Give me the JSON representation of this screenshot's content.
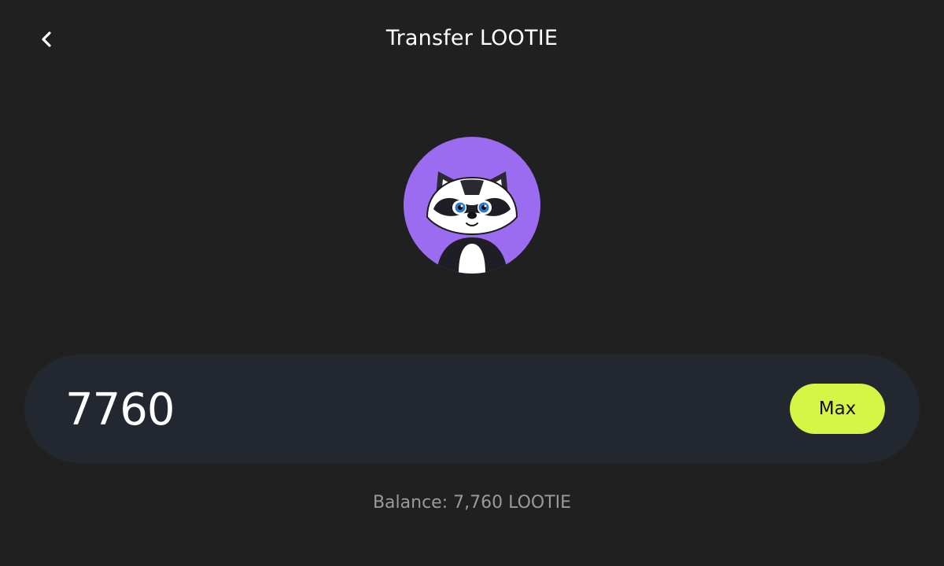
{
  "header": {
    "title": "Transfer LOOTIE",
    "back_icon": "chevron-left-icon"
  },
  "token": {
    "symbol": "LOOTIE",
    "avatar_icon": "raccoon-mascot",
    "avatar_color": "#9b6cf0"
  },
  "amount": {
    "value": "7760",
    "max_label": "Max"
  },
  "balance": {
    "text": "Balance: 7,760 LOOTIE"
  },
  "colors": {
    "background": "#202020",
    "panel": "#232730",
    "accent": "#d6f545",
    "muted_text": "#9a9a9a"
  }
}
